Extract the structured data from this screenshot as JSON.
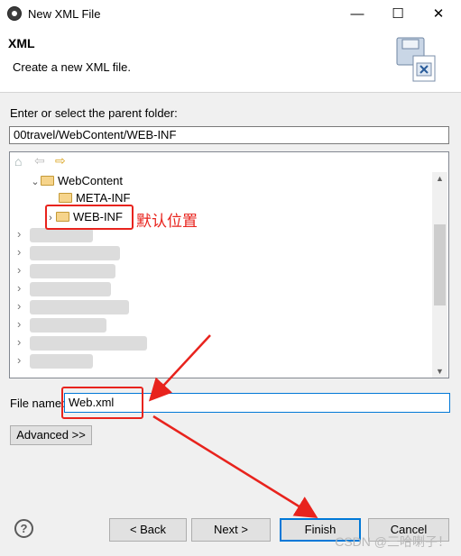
{
  "window": {
    "title": "New XML File",
    "minimize_glyph": "—",
    "maximize_glyph": "☐",
    "close_glyph": "✕"
  },
  "header": {
    "title": "XML",
    "description": "Create a new XML file."
  },
  "parent_folder": {
    "label": "Enter or select the parent folder:",
    "value": "00travel/WebContent/WEB-INF"
  },
  "tree": {
    "toolbar_icons": [
      "home-icon",
      "back-arrow-icon",
      "forward-arrow-icon"
    ],
    "items": [
      {
        "label": "WebContent",
        "expanded": true
      },
      {
        "label": "META-INF"
      },
      {
        "label": "WEB-INF",
        "selected": true
      }
    ]
  },
  "annotation": {
    "default_location_note": "默认位置",
    "accent_color": "#e8231d"
  },
  "file_name": {
    "label": "File name:",
    "value": "Web.xml"
  },
  "buttons": {
    "advanced": "Advanced >>",
    "back": "< Back",
    "next": "Next >",
    "finish": "Finish",
    "cancel": "Cancel",
    "help": "?"
  },
  "watermark": "CSDN @三哈喇子！"
}
